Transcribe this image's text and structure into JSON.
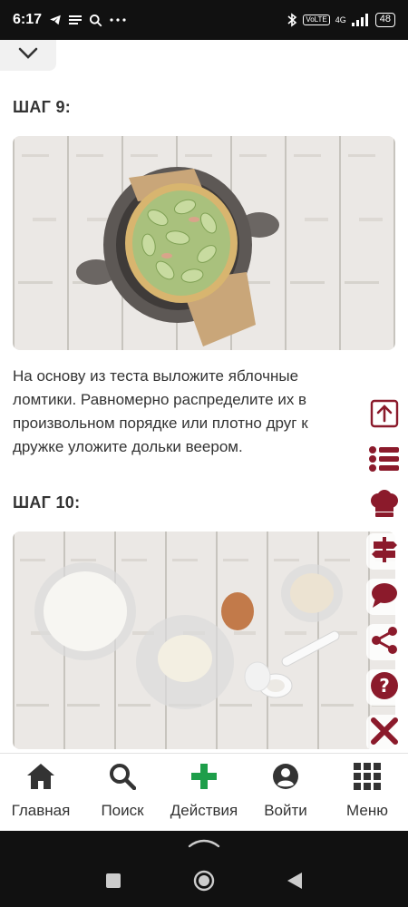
{
  "status_bar": {
    "time": "6:17",
    "battery": "48",
    "network": "4G",
    "volte": "VoLTE"
  },
  "steps": [
    {
      "title": "ШАГ 9:",
      "text": "На основу из теста выложите яблочные ломтики. Равномерно распределите их в произвольном порядке или плотно друг к дружке уложите дольки веером."
    },
    {
      "title": "ШАГ 10:"
    }
  ],
  "side_tools": [
    "arrow-up-box-icon",
    "list-icon",
    "chef-hat-icon",
    "signpost-icon",
    "comment-icon",
    "share-icon",
    "help-icon",
    "close-icon"
  ],
  "bottom_nav": {
    "home": "Главная",
    "search": "Поиск",
    "actions": "Действия",
    "login": "Войти",
    "menu": "Меню"
  },
  "colors": {
    "accent": "#8b1a2b",
    "green": "#1e9e4a"
  }
}
